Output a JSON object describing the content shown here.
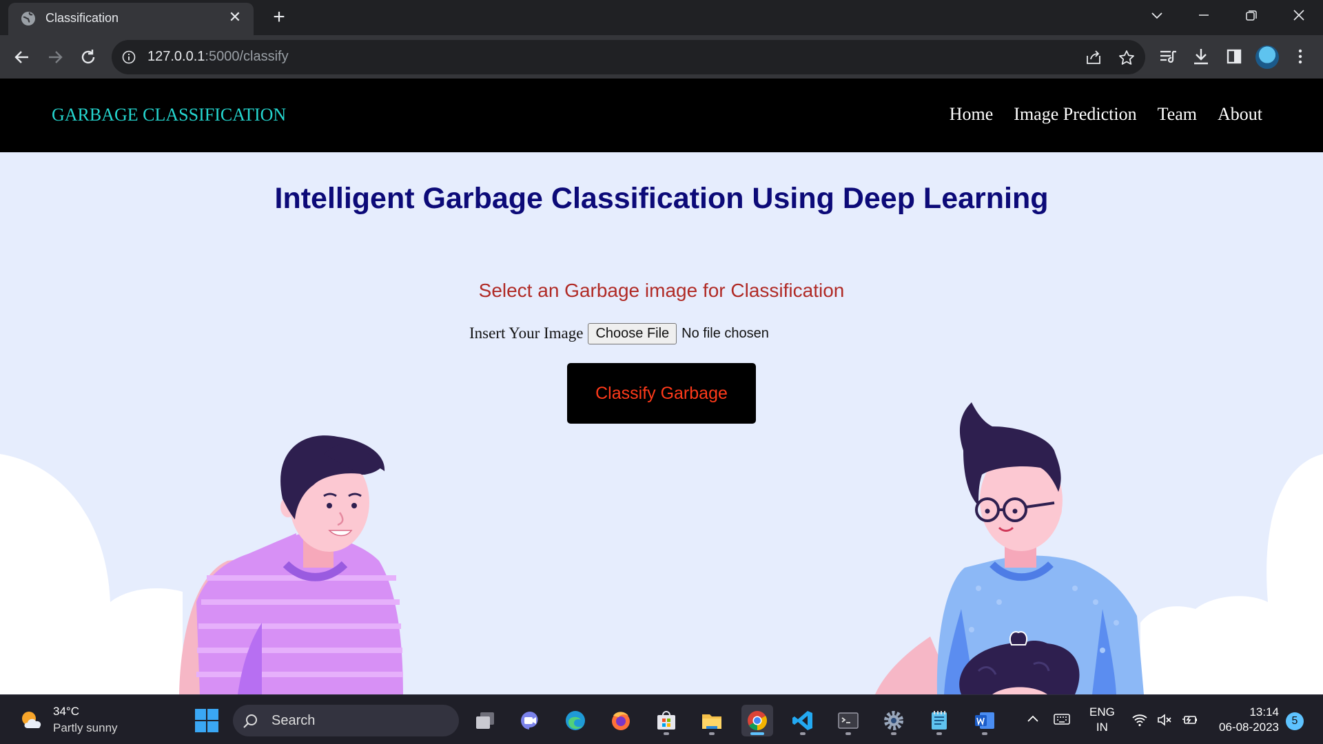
{
  "browser": {
    "tab_title": "Classification",
    "url_host": "127.0.0.1",
    "url_rest": ":5000/classify"
  },
  "site": {
    "brand": "GARBAGE CLASSIFICATION",
    "nav": [
      "Home",
      "Image Prediction",
      "Team",
      "About"
    ]
  },
  "main": {
    "title": "Intelligent Garbage Classification Using Deep Learning",
    "subtitle": "Select an Garbage image for Classification",
    "upload_label": "Insert Your Image",
    "choose_file_label": "Choose File",
    "file_status": "No file chosen",
    "classify_button": "Classify Garbage"
  },
  "taskbar": {
    "weather_temp": "34°C",
    "weather_desc": "Partly sunny",
    "search_placeholder": "Search",
    "apps": [
      "task-view",
      "teams-chat",
      "edge",
      "firefox",
      "microsoft-store",
      "file-explorer",
      "chrome",
      "vscode",
      "terminal",
      "settings",
      "notepad",
      "word"
    ],
    "lang_1": "ENG",
    "lang_2": "IN",
    "time": "13:14",
    "date": "06-08-2023",
    "notification_count": "5"
  },
  "colors": {
    "brand": "#25d6cf",
    "title": "#0c0a78",
    "subtitle": "#b02a25",
    "button_text": "#ff3a1a",
    "page_bg": "#e6edfd"
  }
}
